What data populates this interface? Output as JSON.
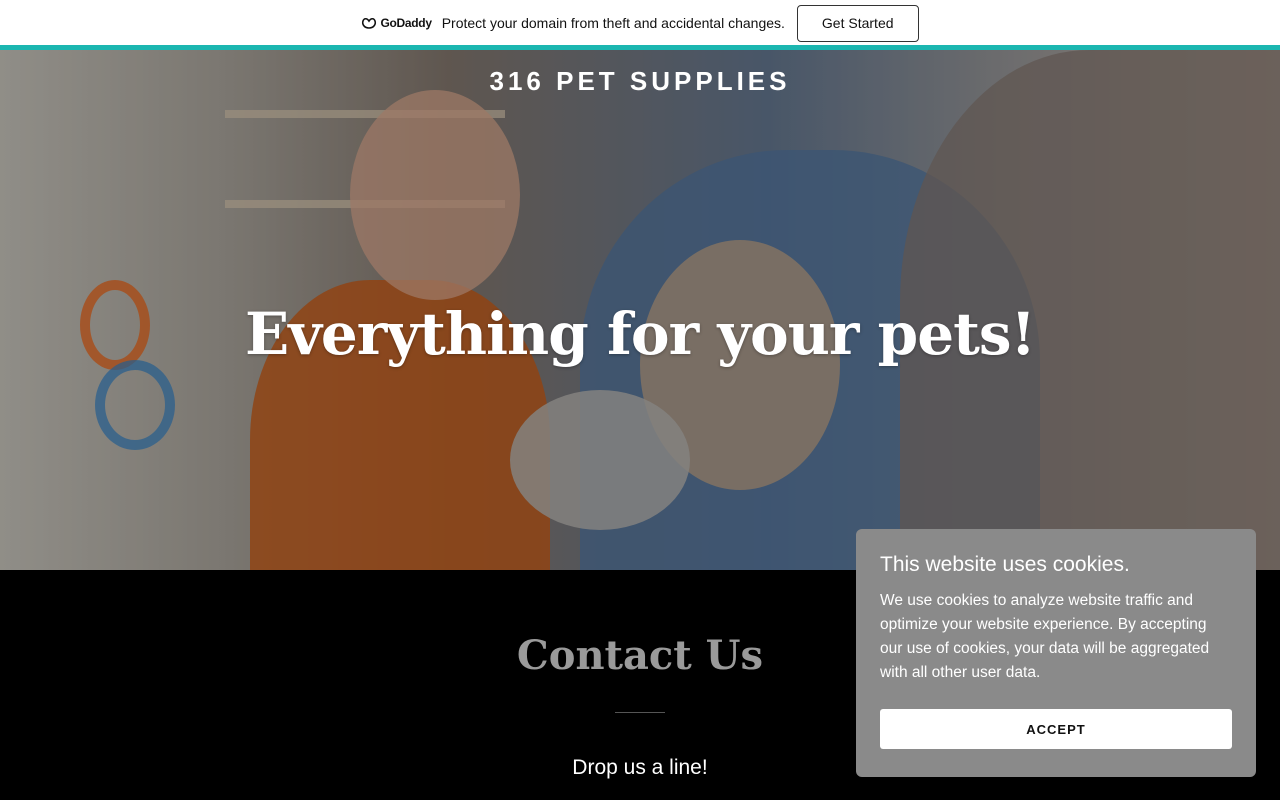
{
  "promo": {
    "logo_text": "GoDaddy",
    "message": "Protect your domain from theft and accidental changes.",
    "button_label": "Get Started",
    "accent_color": "#1bb6b0"
  },
  "hero": {
    "brand": "316 PET SUPPLIES",
    "heading": "Everything for your pets!"
  },
  "contact": {
    "title": "Contact Us",
    "subtitle": "Drop us a line!"
  },
  "cookie": {
    "title": "This website uses cookies.",
    "body": "We use cookies to analyze website traffic and optimize your website experience. By accepting our use of cookies, your data will be aggregated with all other user data.",
    "accept_label": "ACCEPT"
  },
  "icons": {
    "godaddy_logo": "godaddy-logo-icon"
  }
}
